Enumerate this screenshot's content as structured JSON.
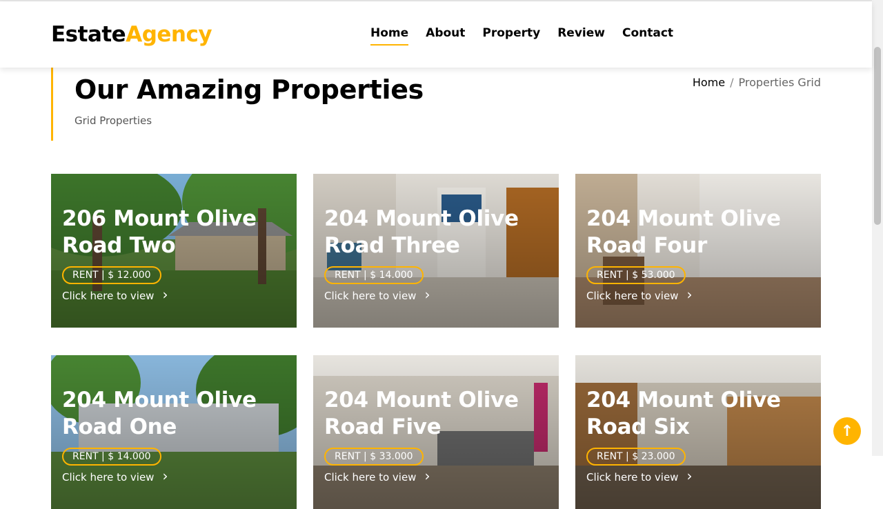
{
  "header": {
    "logo_part1": "Estate",
    "logo_part2": "Agency",
    "nav": [
      {
        "label": "Home",
        "active": true
      },
      {
        "label": "About",
        "active": false
      },
      {
        "label": "Property",
        "active": false
      },
      {
        "label": "Review",
        "active": false
      },
      {
        "label": "Contact",
        "active": false
      }
    ]
  },
  "intro": {
    "title": "Our Amazing Properties",
    "subtitle": "Grid Properties",
    "breadcrumb": {
      "home": "Home",
      "separator": "/",
      "current": "Properties Grid"
    }
  },
  "properties": [
    {
      "title": "206 Mount Olive Road Two",
      "price": "RENT | $ 12.000",
      "link": "Click here to view"
    },
    {
      "title": "204 Mount Olive Road Three",
      "price": "RENT | $ 14.000",
      "link": "Click here to view"
    },
    {
      "title": "204 Mount Olive Road Four",
      "price": "RENT | $ 53.000",
      "link": "Click here to view"
    },
    {
      "title": "204 Mount Olive Road One",
      "price": "RENT | $ 14.000",
      "link": "Click here to view"
    },
    {
      "title": "204 Mount Olive Road Five",
      "price": "RENT | $ 33.000",
      "link": "Click here to view"
    },
    {
      "title": "204 Mount Olive Road Six",
      "price": "RENT | $ 23.000",
      "link": "Click here to view"
    }
  ],
  "icons": {
    "chevron": "chevron-right-icon",
    "scroll_top": "arrow-up-icon"
  },
  "colors": {
    "accent": "#ffb400",
    "text": "#000000"
  }
}
